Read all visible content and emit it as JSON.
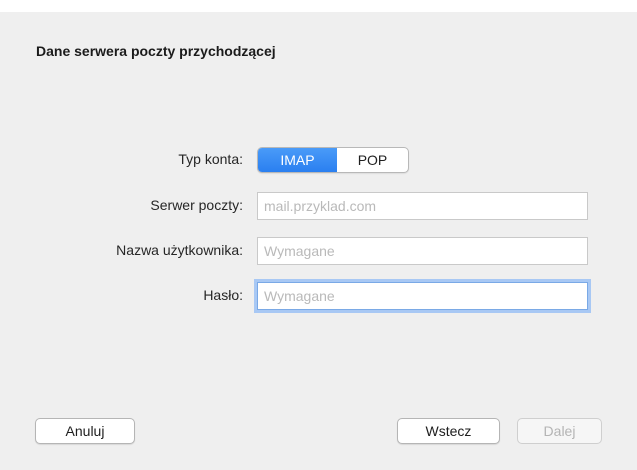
{
  "dialog": {
    "title": "Dane serwera poczty przychodzącej"
  },
  "form": {
    "account_type": {
      "label": "Typ konta:",
      "options": [
        "IMAP",
        "POP"
      ],
      "selected": "IMAP"
    },
    "mail_server": {
      "label": "Serwer poczty:",
      "value": "",
      "placeholder": "mail.przyklad.com"
    },
    "username": {
      "label": "Nazwa użytkownika:",
      "value": "",
      "placeholder": "Wymagane"
    },
    "password": {
      "label": "Hasło:",
      "value": "",
      "placeholder": "Wymagane"
    }
  },
  "buttons": {
    "cancel": "Anuluj",
    "back": "Wstecz",
    "next": "Dalej",
    "next_disabled": true
  },
  "colors": {
    "accent": "#2a7ff0",
    "background": "#efefef",
    "focus_ring": "#a8c8f4"
  }
}
